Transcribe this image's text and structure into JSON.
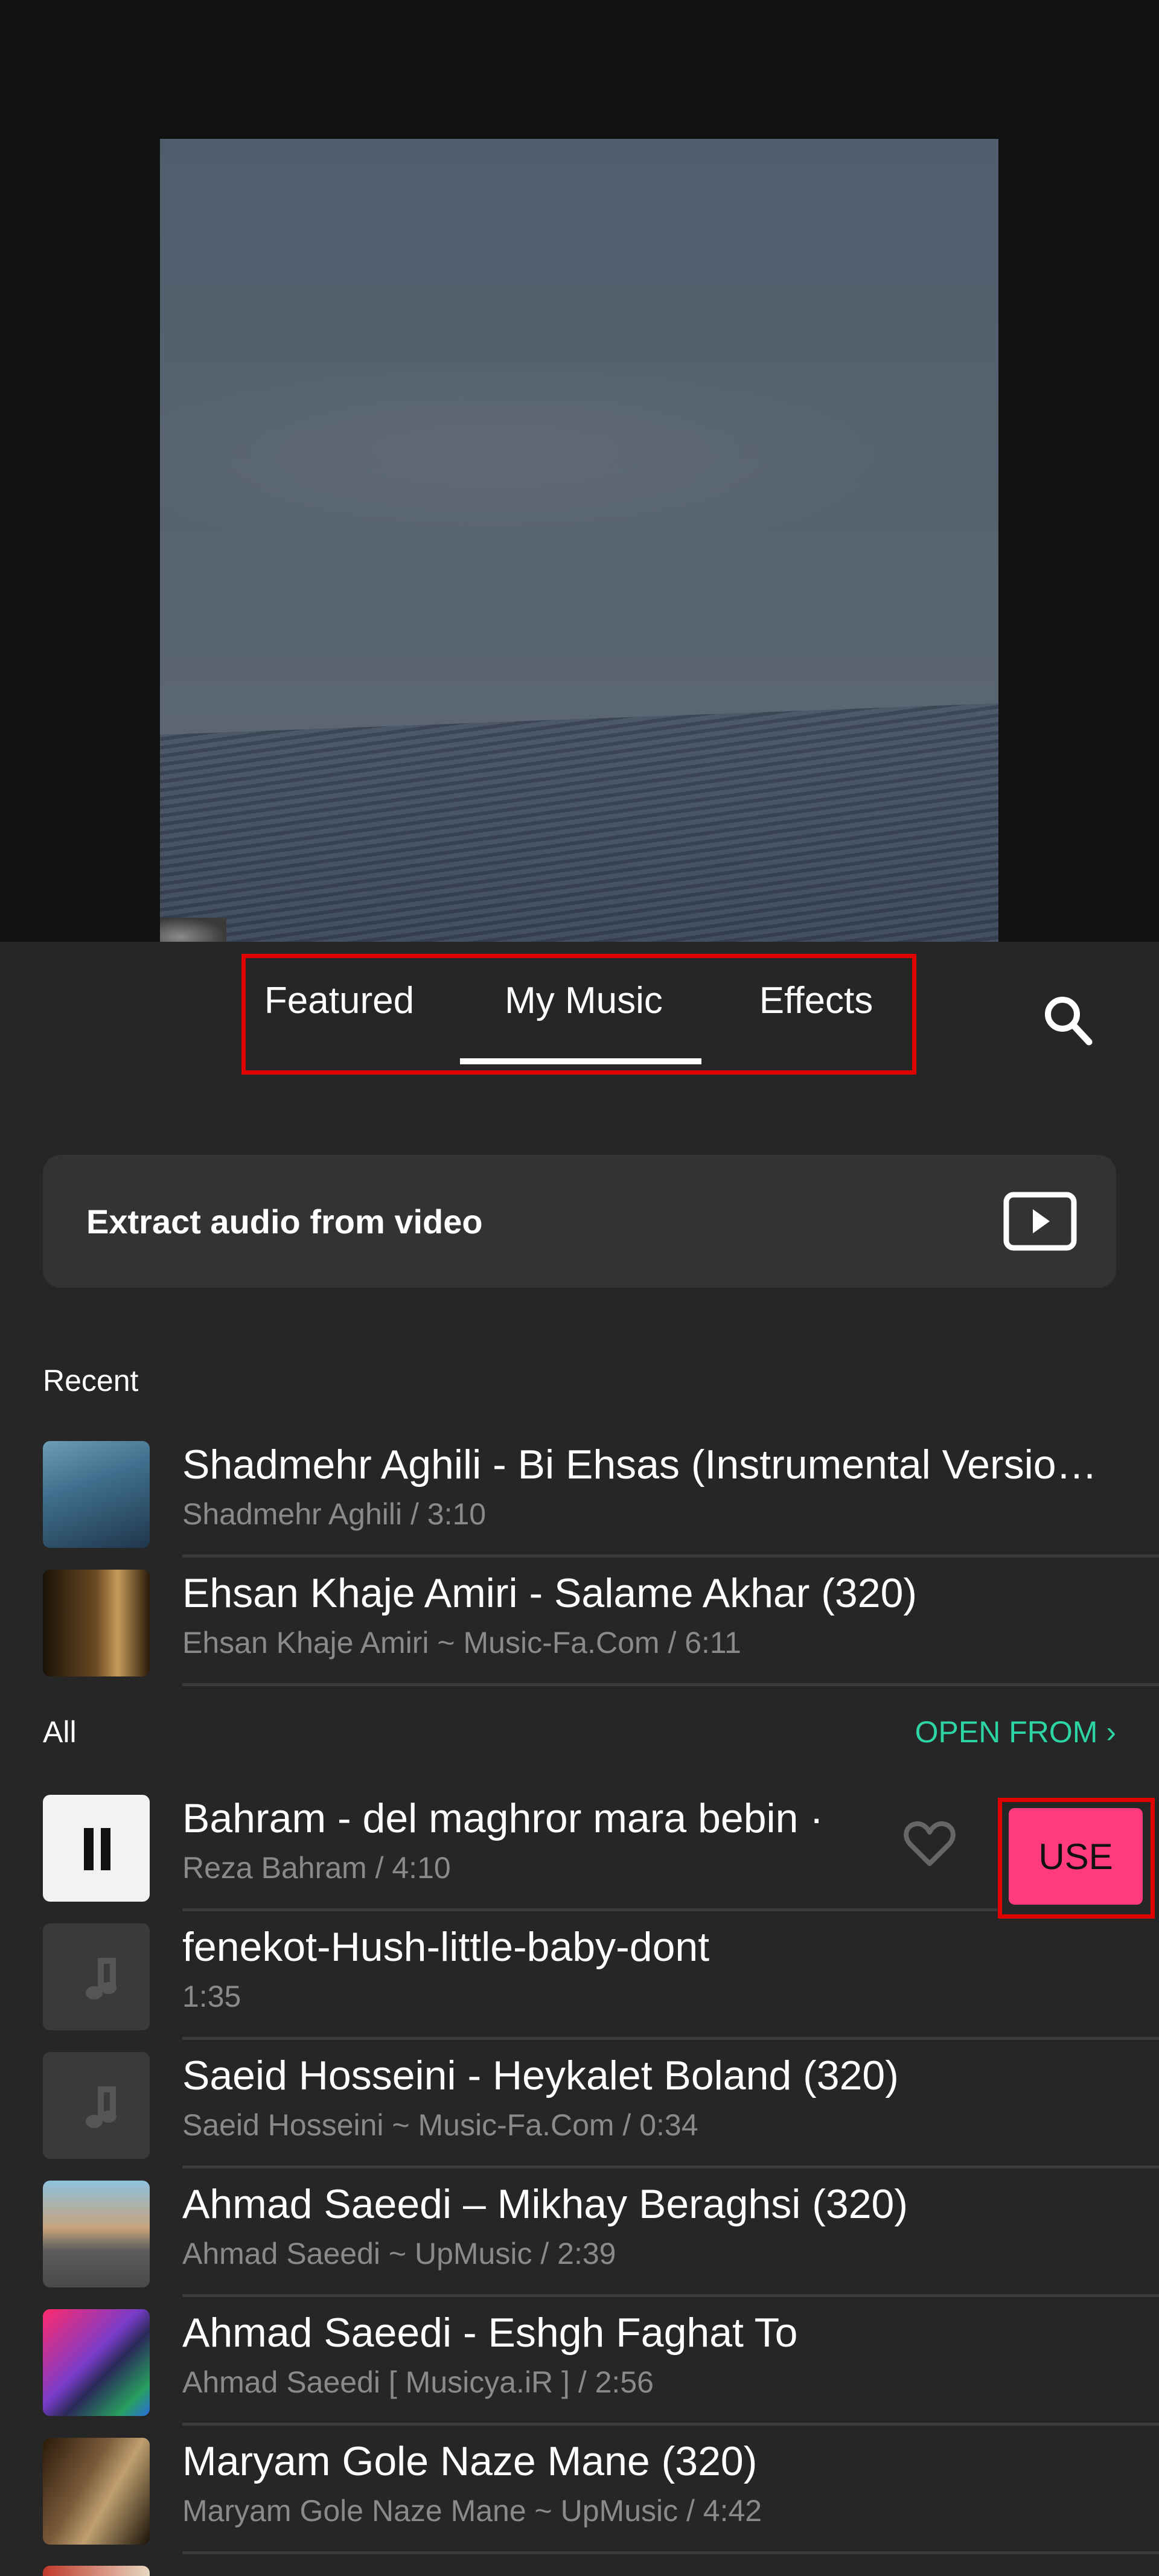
{
  "tabs": {
    "items": [
      {
        "label": "Featured",
        "selected": false
      },
      {
        "label": "My Music",
        "selected": true
      },
      {
        "label": "Effects",
        "selected": false
      }
    ],
    "search_icon": "search-icon"
  },
  "extract": {
    "label": "Extract audio from video",
    "icon": "video-play-icon"
  },
  "recent": {
    "label": "Recent",
    "tracks": [
      {
        "title": "Shadmehr Aghili - Bi Ehsas (Instrumental Versio…",
        "subtitle": "Shadmehr Aghili / 3:10"
      },
      {
        "title": "Ehsan Khaje Amiri - Salame Akhar (320)",
        "subtitle": "Ehsan Khaje Amiri ~ Music-Fa.Com / 6:11"
      }
    ]
  },
  "all": {
    "label": "All",
    "open_from_label": "OPEN FROM",
    "open_from_color": "#2dd4a4",
    "tracks": [
      {
        "title": " Bahram - del maghror mara bebin ·",
        "subtitle": "Reza Bahram / 4:10",
        "playing": true,
        "favorite": false,
        "action_label": "USE"
      },
      {
        "title": "fenekot-Hush-little-baby-dont",
        "subtitle": "1:35"
      },
      {
        "title": "Saeid Hosseini - Heykalet Boland (320)",
        "subtitle": "Saeid Hosseini ~ Music-Fa.Com / 0:34"
      },
      {
        "title": "Ahmad Saeedi – Mikhay Beraghsi (320)",
        "subtitle": "Ahmad Saeedi ~ UpMusic / 2:39"
      },
      {
        "title": "Ahmad Saeedi - Eshgh Faghat To",
        "subtitle": "Ahmad Saeedi [ Musicya.iR ]  / 2:56"
      },
      {
        "title": "Maryam Gole Naze Mane (320)",
        "subtitle": "Maryam Gole Naze Mane ~ UpMusic / 4:42"
      }
    ]
  },
  "colors": {
    "accent_use": "#ff3a7f",
    "highlight": "#e00000",
    "background": "#262626"
  }
}
